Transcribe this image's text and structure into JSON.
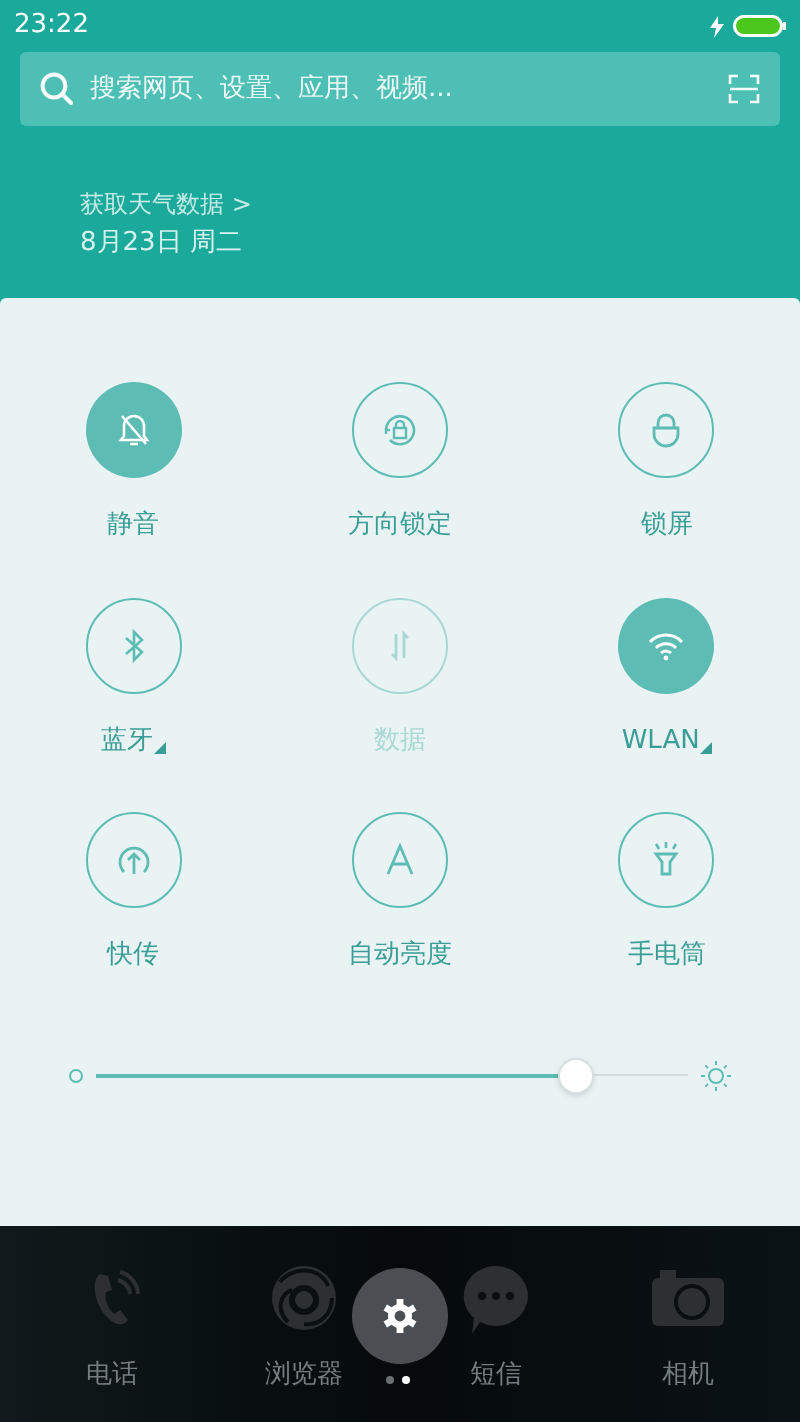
{
  "status_bar": {
    "time": "23:22",
    "charging": true
  },
  "search": {
    "placeholder": "搜索网页、设置、应用、视频..."
  },
  "weather": {
    "link": "获取天气数据 >",
    "date": "8月23日 周二"
  },
  "toggles": [
    {
      "label": "静音",
      "on": true,
      "disabled": false,
      "has_menu": false
    },
    {
      "label": "方向锁定",
      "on": false,
      "disabled": false,
      "has_menu": false
    },
    {
      "label": "锁屏",
      "on": false,
      "disabled": false,
      "has_menu": false
    },
    {
      "label": "蓝牙",
      "on": false,
      "disabled": false,
      "has_menu": true
    },
    {
      "label": "数据",
      "on": false,
      "disabled": true,
      "has_menu": false
    },
    {
      "label": "WLAN",
      "on": true,
      "disabled": false,
      "has_menu": true
    },
    {
      "label": "快传",
      "on": false,
      "disabled": false,
      "has_menu": false
    },
    {
      "label": "自动亮度",
      "on": false,
      "disabled": false,
      "has_menu": false
    },
    {
      "label": "手电筒",
      "on": false,
      "disabled": false,
      "has_menu": false
    }
  ],
  "brightness": {
    "level": 0.81
  },
  "dock": [
    {
      "label": "电话"
    },
    {
      "label": "浏览器"
    },
    {
      "label": "短信"
    },
    {
      "label": "相机"
    }
  ],
  "pages": [
    {
      "selected": false
    },
    {
      "selected": true
    }
  ]
}
